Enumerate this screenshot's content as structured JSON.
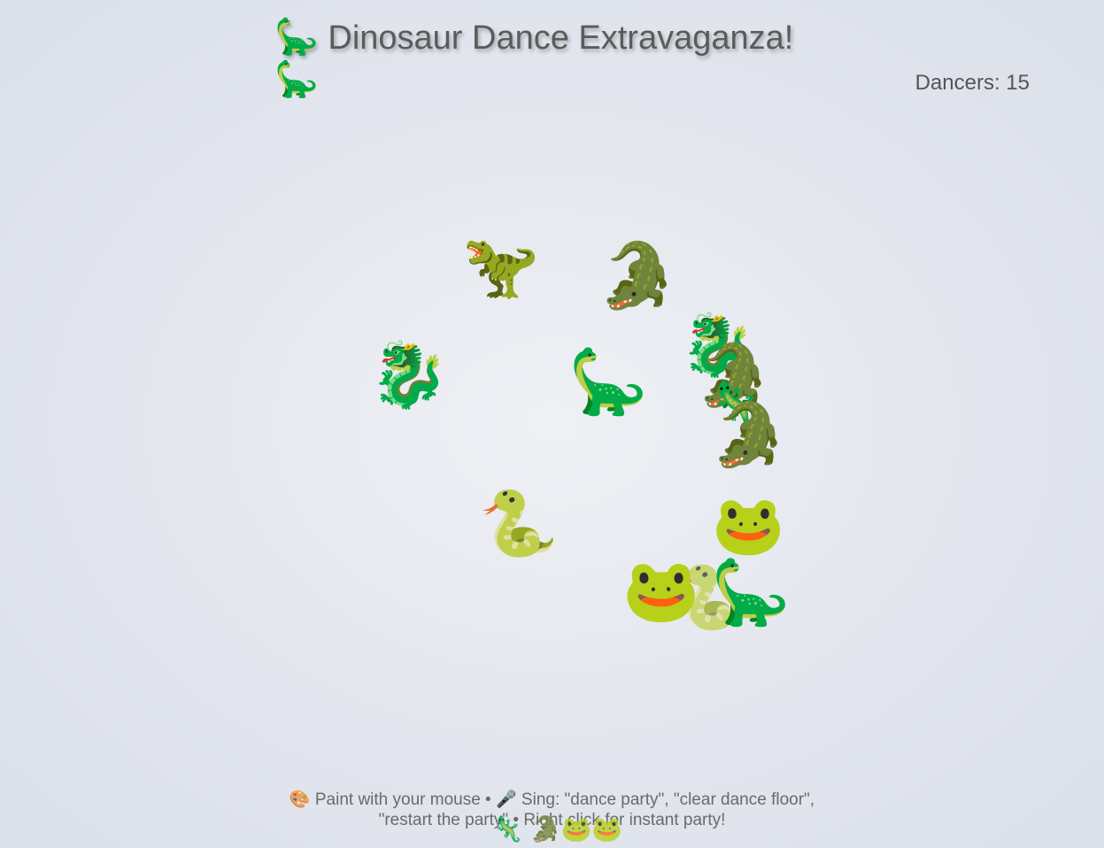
{
  "header": {
    "title_emoji": "🦕",
    "title": "Dinosaur Dance Extravaganza!",
    "title_emoji_end": "🦕"
  },
  "counter": {
    "label": "Dancers: 15"
  },
  "dancers": [
    {
      "emoji": "🦖",
      "name": "trex"
    },
    {
      "emoji": "🐊",
      "name": "crocodile"
    },
    {
      "emoji": "🐉",
      "name": "dragon"
    },
    {
      "emoji": "🦕",
      "name": "sauropod"
    },
    {
      "emoji": "🐉",
      "name": "dragon"
    },
    {
      "emoji": "🐊",
      "name": "crocodile"
    },
    {
      "emoji": "🦎",
      "name": "lizard"
    },
    {
      "emoji": "🐊",
      "name": "crocodile"
    },
    {
      "emoji": "🐍",
      "name": "snake"
    },
    {
      "emoji": "🐸",
      "name": "frog"
    },
    {
      "emoji": "🐸",
      "name": "frog"
    },
    {
      "emoji": "🐍",
      "name": "snake"
    },
    {
      "emoji": "🦕",
      "name": "sauropod"
    }
  ],
  "instructions": {
    "text": "🎨 Paint with your mouse • 🎤 Sing: \"dance party\", \"clear dance floor\", \"restart the party\" • Right click for instant party!"
  },
  "footer": {
    "emojis": "🦎 🐊🐸🐸"
  }
}
